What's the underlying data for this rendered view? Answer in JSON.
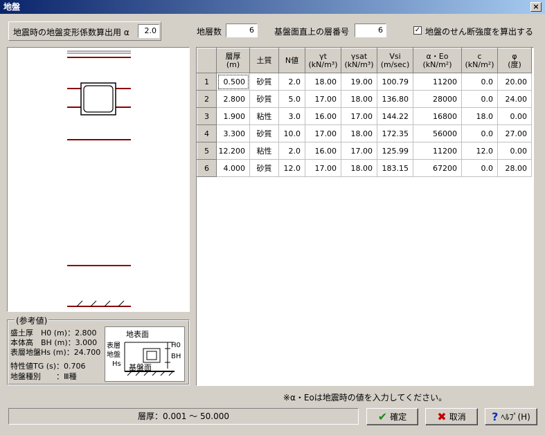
{
  "window": {
    "title": "地盤",
    "close_glyph": "×"
  },
  "alpha": {
    "label": "地震時の地盤変形係数算出用 α",
    "value": "2.0"
  },
  "layers_count": {
    "label": "地層数",
    "value": "6"
  },
  "base_layer": {
    "label": "基盤面直上の層番号",
    "value": "6"
  },
  "shear_check": {
    "label": "地盤のせん断強度を算出する",
    "checked": true,
    "glyph": "✓"
  },
  "table": {
    "headers": [
      "",
      "層厚\n(m)",
      "土質",
      "N値",
      "γt\n(kN/m³)",
      "γsat\n(kN/m³)",
      "Vsi\n(m/sec)",
      "α・Eo\n(kN/m²)",
      "c\n(kN/m²)",
      "φ\n(度)"
    ],
    "rows": [
      [
        "1",
        "0.500",
        "砂質",
        "2.0",
        "18.00",
        "19.00",
        "100.79",
        "11200",
        "0.0",
        "20.00"
      ],
      [
        "2",
        "2.800",
        "砂質",
        "5.0",
        "17.00",
        "18.00",
        "136.80",
        "28000",
        "0.0",
        "24.00"
      ],
      [
        "3",
        "1.900",
        "粘性",
        "3.0",
        "16.00",
        "17.00",
        "144.22",
        "16800",
        "18.0",
        "0.00"
      ],
      [
        "4",
        "3.300",
        "砂質",
        "10.0",
        "17.00",
        "18.00",
        "172.35",
        "56000",
        "0.0",
        "27.00"
      ],
      [
        "5",
        "12.200",
        "粘性",
        "2.0",
        "16.00",
        "17.00",
        "125.99",
        "11200",
        "12.0",
        "0.00"
      ],
      [
        "6",
        "4.000",
        "砂質",
        "12.0",
        "17.00",
        "18.00",
        "183.15",
        "67200",
        "0.0",
        "28.00"
      ]
    ]
  },
  "reference": {
    "title": "(参考値)",
    "rows": [
      "盛土厚　H0 (m)：2.800",
      "本体高　BH (m)：3.000",
      "表層地盤Hs (m)：24.700",
      "特性値TG (s)：0.706",
      "地盤種別　　：Ⅲ種"
    ],
    "figure": {
      "ground_surface": "地表面",
      "h0": "H0",
      "bh": "BH",
      "surface_layer": "表層\n地盤\nHs",
      "base_surface": "基盤面"
    }
  },
  "note": "※α・Eoは地震時の値を入力してください。",
  "status_range": "層厚：0.001 〜 50.000",
  "buttons": {
    "ok": "確定",
    "cancel": "取消",
    "help": "ﾍﾙﾌﾟ(H)"
  },
  "icons": {
    "ok": "check-icon",
    "cancel": "x-icon",
    "help": "question-icon"
  },
  "colors": {
    "title_start": "#0a246a",
    "title_end": "#a6caf0",
    "layer_line": "#8b0000",
    "face": "#d4d0c8"
  }
}
